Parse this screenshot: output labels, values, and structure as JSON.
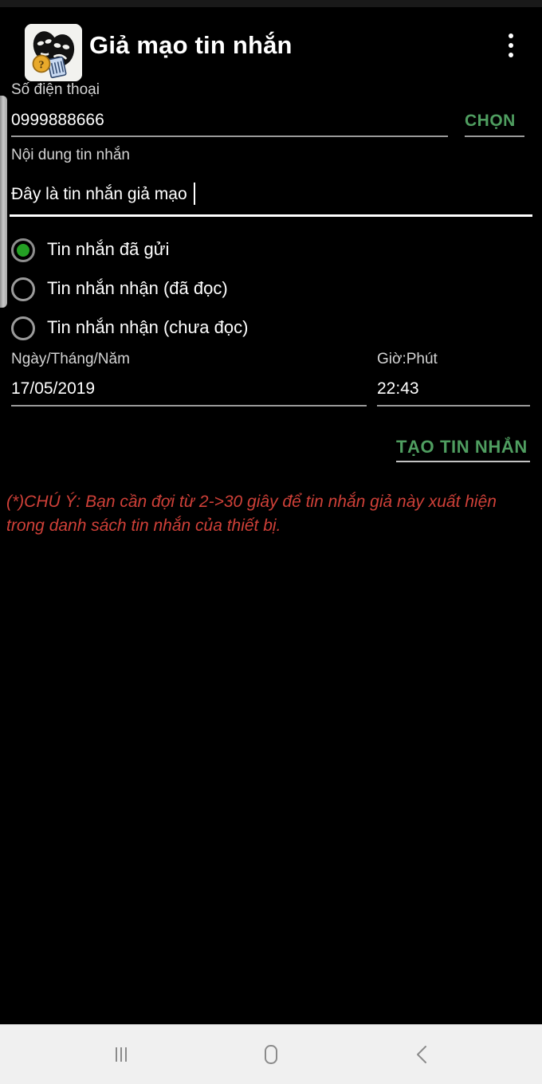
{
  "app": {
    "title": "Giả mạo tin nhắn",
    "icon_name": "theater-masks-app-icon",
    "overflow_menu_label": "⋮"
  },
  "form": {
    "phone": {
      "label": "Số điện thoại",
      "value": "0999888666",
      "placeholder": "Số điện thoại"
    },
    "pick_contact_button": "CHỌN",
    "message": {
      "label": "Nội dung tin nhắn",
      "value": "Đây là tin nhắn giả mạo",
      "placeholder": "Nội dung tin nhắn"
    },
    "message_type": {
      "selected_index": 0,
      "options": [
        "Tin nhắn đã gửi",
        "Tin nhắn nhận (đã đọc)",
        "Tin nhắn nhận (chưa đọc)"
      ]
    },
    "date": {
      "label": "Ngày/Tháng/Năm",
      "value": "17/05/2019"
    },
    "time": {
      "label": "Giờ:Phút",
      "value": "22:43"
    },
    "create_button": "TẠO TIN NHẮN"
  },
  "warning": {
    "text": "(*)CHÚ Ý: Bạn cần đợi từ 2->30 giây để tin nhắn giả này xuất hiện trong danh sách tin nhắn của thiết bị."
  },
  "navbar": {
    "recents": "recents-icon",
    "home": "home-icon",
    "back": "back-icon"
  },
  "colors": {
    "background": "#000000",
    "accent_green": "#4f9e60",
    "radio_green": "#24a024",
    "warning_red": "#cf4038",
    "navbar_background": "#f0f0f0"
  }
}
